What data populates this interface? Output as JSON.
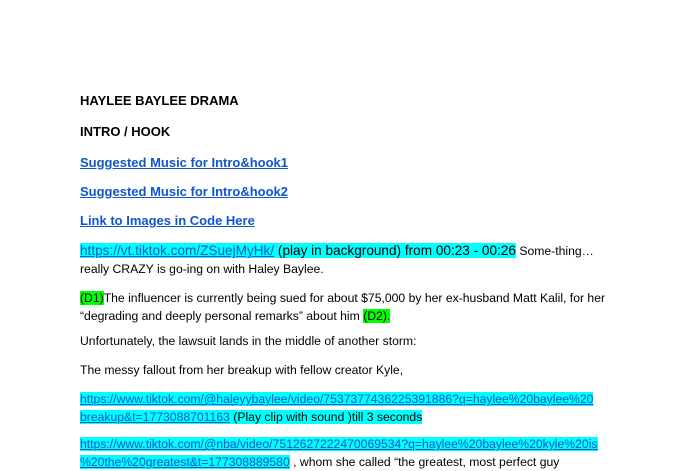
{
  "doc": {
    "title": "HAYLEE BAYLEE DRAMA",
    "section": "INTRO / HOOK",
    "links": [
      "Suggested Music for Intro&hook1",
      "Suggested Music for Intro&hook2",
      "Link to Images in Code Here"
    ],
    "p1": {
      "url": "https://vt.tiktok.com/ZSuejMyHk/",
      "note": " (play in background) from 00:23 - 00:26",
      "text1": " Some-thing…",
      "text2": "really CRAZY is go-ing on with Haley Baylee."
    },
    "p2": {
      "tag1": "(D1)",
      "text1": "The influencer is currently being sued for about $75,000 by her ex-husband Matt Kalil, for her",
      "text2": "“degrading and deeply personal remarks” about him ",
      "tag2": "(D2)."
    },
    "p3": "Unfortunately, the lawsuit lands in the middle of another storm:",
    "p4": "The messy fallout from her breakup with fellow creator Kyle,",
    "p5": {
      "url_line1": "https://www.tiktok.com/@haleyybaylee/video/7537377436225391886?q=haylee%20baylee%20",
      "url_line2": "breakup&t=1773088701163",
      "note": "  (Play clip with sound )till 3 seconds"
    },
    "p6": {
      "url_line1": "https://www.tiktok.com/@nba/video/7512627222470069534?q=haylee%20baylee%20kyle%20is",
      "url_line2": "%20the%20greatest&t=177308889580",
      "text2": " , whom she called “the greatest, most perfect guy"
    }
  }
}
